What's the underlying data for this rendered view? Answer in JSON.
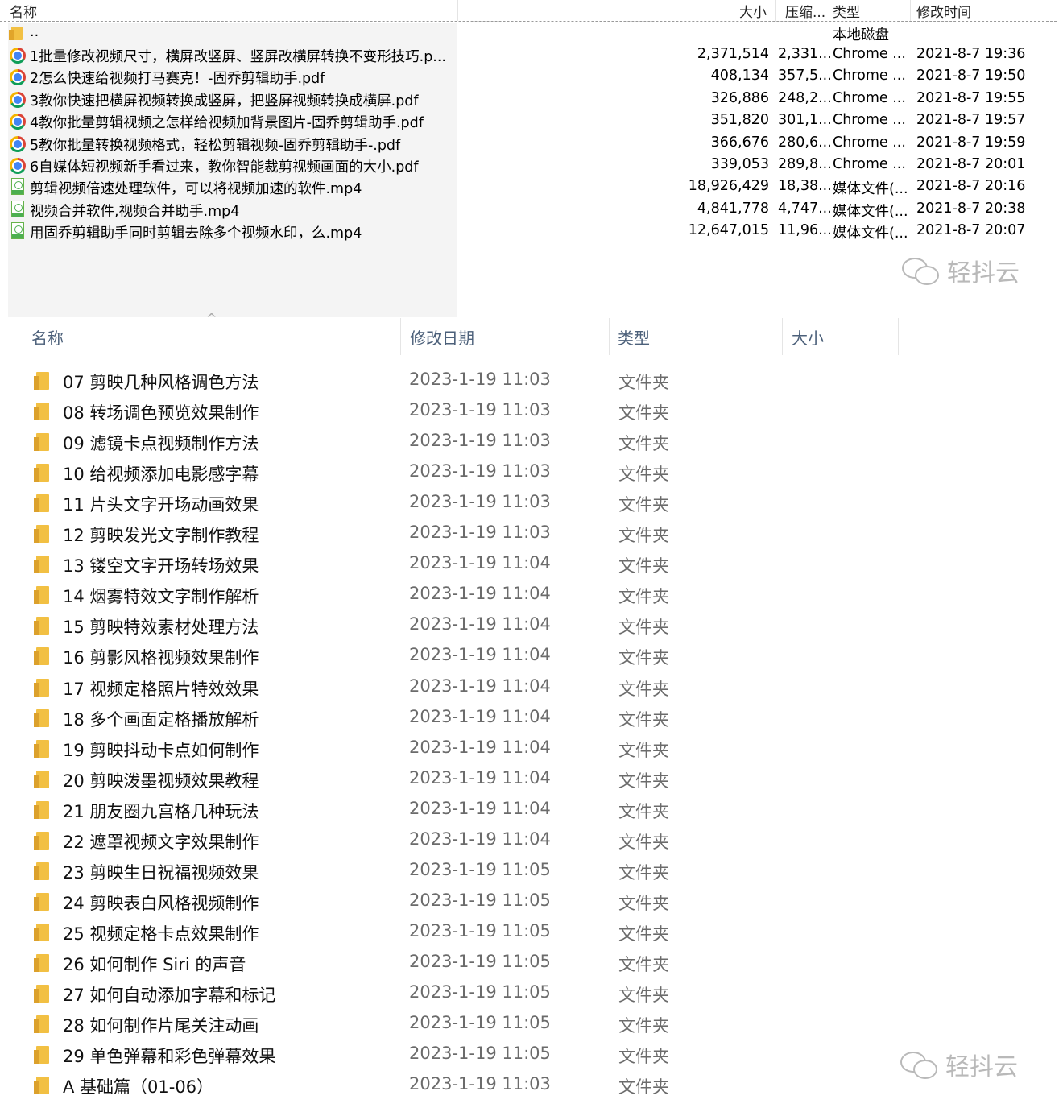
{
  "top_panel": {
    "columns": {
      "name": "名称",
      "size": "大小",
      "compressed": "压缩...",
      "type": "类型",
      "modified": "修改时间"
    },
    "parent_row": {
      "name": "..",
      "type": "本地磁盘"
    },
    "files": [
      {
        "icon": "chrome-icon",
        "name": "1批量修改视频尺寸，横屏改竖屏、竖屏改横屏转换不变形技巧.p...",
        "size": "2,371,514",
        "compressed": "2,331...",
        "type": "Chrome ...",
        "modified": "2021-8-7 19:36"
      },
      {
        "icon": "chrome-icon",
        "name": "2怎么快速给视频打马赛克！-固乔剪辑助手.pdf",
        "size": "408,134",
        "compressed": "357,5...",
        "type": "Chrome ...",
        "modified": "2021-8-7 19:50"
      },
      {
        "icon": "chrome-icon",
        "name": "3教你快速把横屏视频转换成竖屏，把竖屏视频转换成横屏.pdf",
        "size": "326,886",
        "compressed": "248,2...",
        "type": "Chrome ...",
        "modified": "2021-8-7 19:55"
      },
      {
        "icon": "chrome-icon",
        "name": "4教你批量剪辑视频之怎样给视频加背景图片-固乔剪辑助手.pdf",
        "size": "351,820",
        "compressed": "301,1...",
        "type": "Chrome ...",
        "modified": "2021-8-7 19:57"
      },
      {
        "icon": "chrome-icon",
        "name": "5教你批量转换视频格式，轻松剪辑视频-固乔剪辑助手-.pdf",
        "size": "366,676",
        "compressed": "280,6...",
        "type": "Chrome ...",
        "modified": "2021-8-7 19:59"
      },
      {
        "icon": "chrome-icon",
        "name": "6自媒体短视频新手看过来，教你智能裁剪视频画面的大小.pdf",
        "size": "339,053",
        "compressed": "289,8...",
        "type": "Chrome ...",
        "modified": "2021-8-7 20:01"
      },
      {
        "icon": "mp4-icon",
        "name": "剪辑视频倍速处理软件，可以将视频加速的软件.mp4",
        "size": "18,926,429",
        "compressed": "18,38...",
        "type": "媒体文件(...",
        "modified": "2021-8-7 20:16"
      },
      {
        "icon": "mp4-icon",
        "name": "视频合并软件,视频合并助手.mp4",
        "size": "4,841,778",
        "compressed": "4,747...",
        "type": "媒体文件(...",
        "modified": "2021-8-7 20:38"
      },
      {
        "icon": "mp4-icon",
        "name": "用固乔剪辑助手同时剪辑去除多个视频水印，么.mp4",
        "size": "12,647,015",
        "compressed": "11,96...",
        "type": "媒体文件(...",
        "modified": "2021-8-7 20:07"
      }
    ]
  },
  "watermark": {
    "text": "轻抖云"
  },
  "bottom_panel": {
    "columns": {
      "name": "名称",
      "modified": "修改日期",
      "type": "类型",
      "size": "大小"
    },
    "folders": [
      {
        "name": "07  剪映几种风格调色方法",
        "modified": "2023-1-19 11:03",
        "type": "文件夹"
      },
      {
        "name": "08  转场调色预览效果制作",
        "modified": "2023-1-19 11:03",
        "type": "文件夹"
      },
      {
        "name": "09  滤镜卡点视频制作方法",
        "modified": "2023-1-19 11:03",
        "type": "文件夹"
      },
      {
        "name": "10  给视频添加电影感字幕",
        "modified": "2023-1-19 11:03",
        "type": "文件夹"
      },
      {
        "name": "11  片头文字开场动画效果",
        "modified": "2023-1-19 11:03",
        "type": "文件夹"
      },
      {
        "name": "12  剪映发光文字制作教程",
        "modified": "2023-1-19 11:03",
        "type": "文件夹"
      },
      {
        "name": "13  镂空文字开场转场效果",
        "modified": "2023-1-19 11:04",
        "type": "文件夹"
      },
      {
        "name": "14  烟雾特效文字制作解析",
        "modified": "2023-1-19 11:04",
        "type": "文件夹"
      },
      {
        "name": "15  剪映特效素材处理方法",
        "modified": "2023-1-19 11:04",
        "type": "文件夹"
      },
      {
        "name": "16  剪影风格视频效果制作",
        "modified": "2023-1-19 11:04",
        "type": "文件夹"
      },
      {
        "name": "17  视频定格照片特效效果",
        "modified": "2023-1-19 11:04",
        "type": "文件夹"
      },
      {
        "name": "18  多个画面定格播放解析",
        "modified": "2023-1-19 11:04",
        "type": "文件夹"
      },
      {
        "name": "19  剪映抖动卡点如何制作",
        "modified": "2023-1-19 11:04",
        "type": "文件夹"
      },
      {
        "name": "20  剪映泼墨视频效果教程",
        "modified": "2023-1-19 11:04",
        "type": "文件夹"
      },
      {
        "name": "21  朋友圈九宫格几种玩法",
        "modified": "2023-1-19 11:04",
        "type": "文件夹"
      },
      {
        "name": "22  遮罩视频文字效果制作",
        "modified": "2023-1-19 11:04",
        "type": "文件夹"
      },
      {
        "name": "23  剪映生日祝福视频效果",
        "modified": "2023-1-19 11:05",
        "type": "文件夹"
      },
      {
        "name": "24  剪映表白风格视频制作",
        "modified": "2023-1-19 11:05",
        "type": "文件夹"
      },
      {
        "name": "25  视频定格卡点效果制作",
        "modified": "2023-1-19 11:05",
        "type": "文件夹"
      },
      {
        "name": "26  如何制作 Siri 的声音",
        "modified": "2023-1-19 11:05",
        "type": "文件夹"
      },
      {
        "name": "27  如何自动添加字幕和标记",
        "modified": "2023-1-19 11:05",
        "type": "文件夹"
      },
      {
        "name": "28  如何制作片尾关注动画",
        "modified": "2023-1-19 11:05",
        "type": "文件夹"
      },
      {
        "name": "29  单色弹幕和彩色弹幕效果",
        "modified": "2023-1-19 11:05",
        "type": "文件夹"
      },
      {
        "name": "A 基础篇（01-06）",
        "modified": "2023-1-19 11:03",
        "type": "文件夹"
      }
    ]
  }
}
